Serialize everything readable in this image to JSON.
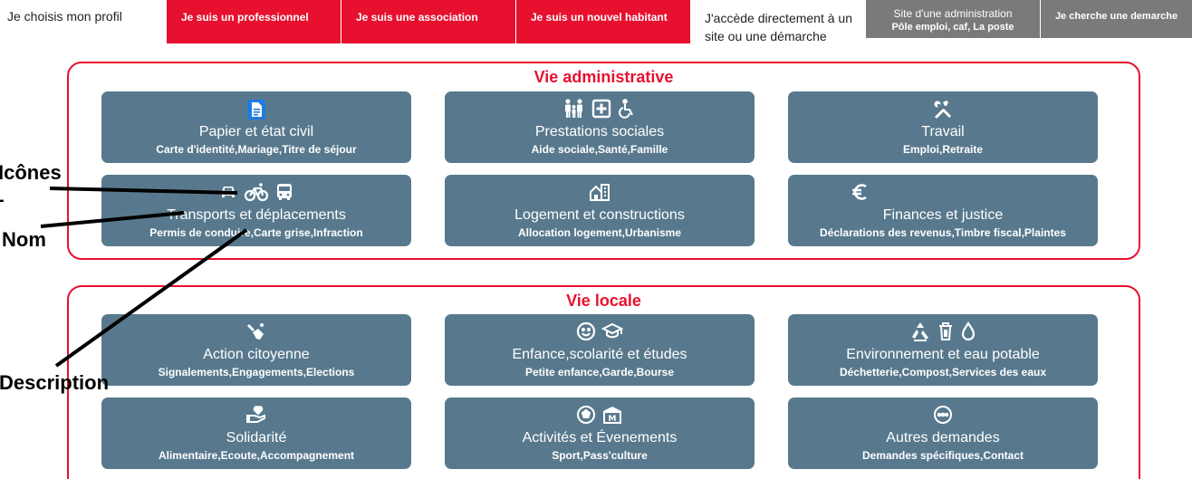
{
  "topbar": {
    "profile_label": "Je choisis mon profil",
    "professional": "Je suis un professionnel",
    "association": "Je suis une association",
    "new_resident": "Je suis un nouvel habitant",
    "direct_access": "J'accède directement à un site ou une démarche",
    "admin_site_line1": "Site d'une administration",
    "admin_site_line2": "Pôle emploi, caf, La poste",
    "find_procedure": "Je cherche une demarche"
  },
  "sections": {
    "admin": {
      "title": "Vie administrative",
      "cards": [
        {
          "name": "Papier et état civil",
          "desc": "Carte d'identité,Mariage,Titre de séjour",
          "icons": [
            "document-icon"
          ]
        },
        {
          "name": "Prestations sociales",
          "desc": "Aide sociale,Santé,Famille",
          "icons": [
            "family-icon",
            "medical-cross-icon",
            "wheelchair-icon"
          ]
        },
        {
          "name": "Travail",
          "desc": "Emploi,Retraite",
          "icons": [
            "tools-icon"
          ]
        },
        {
          "name": "Transports et déplacements",
          "desc": "Permis de conduire,Carte grise,Infraction",
          "icons": [
            "car-icon",
            "bicycle-icon",
            "bus-icon"
          ]
        },
        {
          "name": "Logement et constructions",
          "desc": "Allocation logement,Urbanisme",
          "icons": [
            "house-building-icon"
          ]
        },
        {
          "name": "Finances et justice",
          "desc": "Déclarations des revenus,Timbre fiscal,Plaintes",
          "icons": [
            "euro-icon"
          ]
        }
      ]
    },
    "local": {
      "title": "Vie locale",
      "cards": [
        {
          "name": "Action citoyenne",
          "desc": "Signalements,Engagements,Elections",
          "icons": [
            "hands-icon"
          ]
        },
        {
          "name": "Enfance,scolarité et études",
          "desc": "Petite enfance,Garde,Bourse",
          "icons": [
            "smiley-icon",
            "graduation-cap-icon"
          ]
        },
        {
          "name": "Environnement et eau potable",
          "desc": "Déchetterie,Compost,Services des eaux",
          "icons": [
            "recycle-icon",
            "trash-icon",
            "water-drop-icon"
          ]
        },
        {
          "name": "Solidarité",
          "desc": "Alimentaire,Ecoute,Accompagnement",
          "icons": [
            "hand-heart-icon"
          ]
        },
        {
          "name": "Activités et Évenements",
          "desc": "Sport,Pass'culture",
          "icons": [
            "soccer-ball-icon",
            "museum-icon"
          ]
        },
        {
          "name": "Autres demandes",
          "desc": "Demandes spécifiques,Contact",
          "icons": [
            "more-icon"
          ]
        }
      ]
    }
  },
  "annotations": {
    "icons": "Icônes",
    "dash": "-",
    "name": "Nom",
    "description": "Description"
  },
  "colors": {
    "accent_red": "#e8102f",
    "card_bg": "#58798d",
    "grey_tab": "#7a7a7a",
    "doc_icon_blue": "#1e7be0"
  }
}
